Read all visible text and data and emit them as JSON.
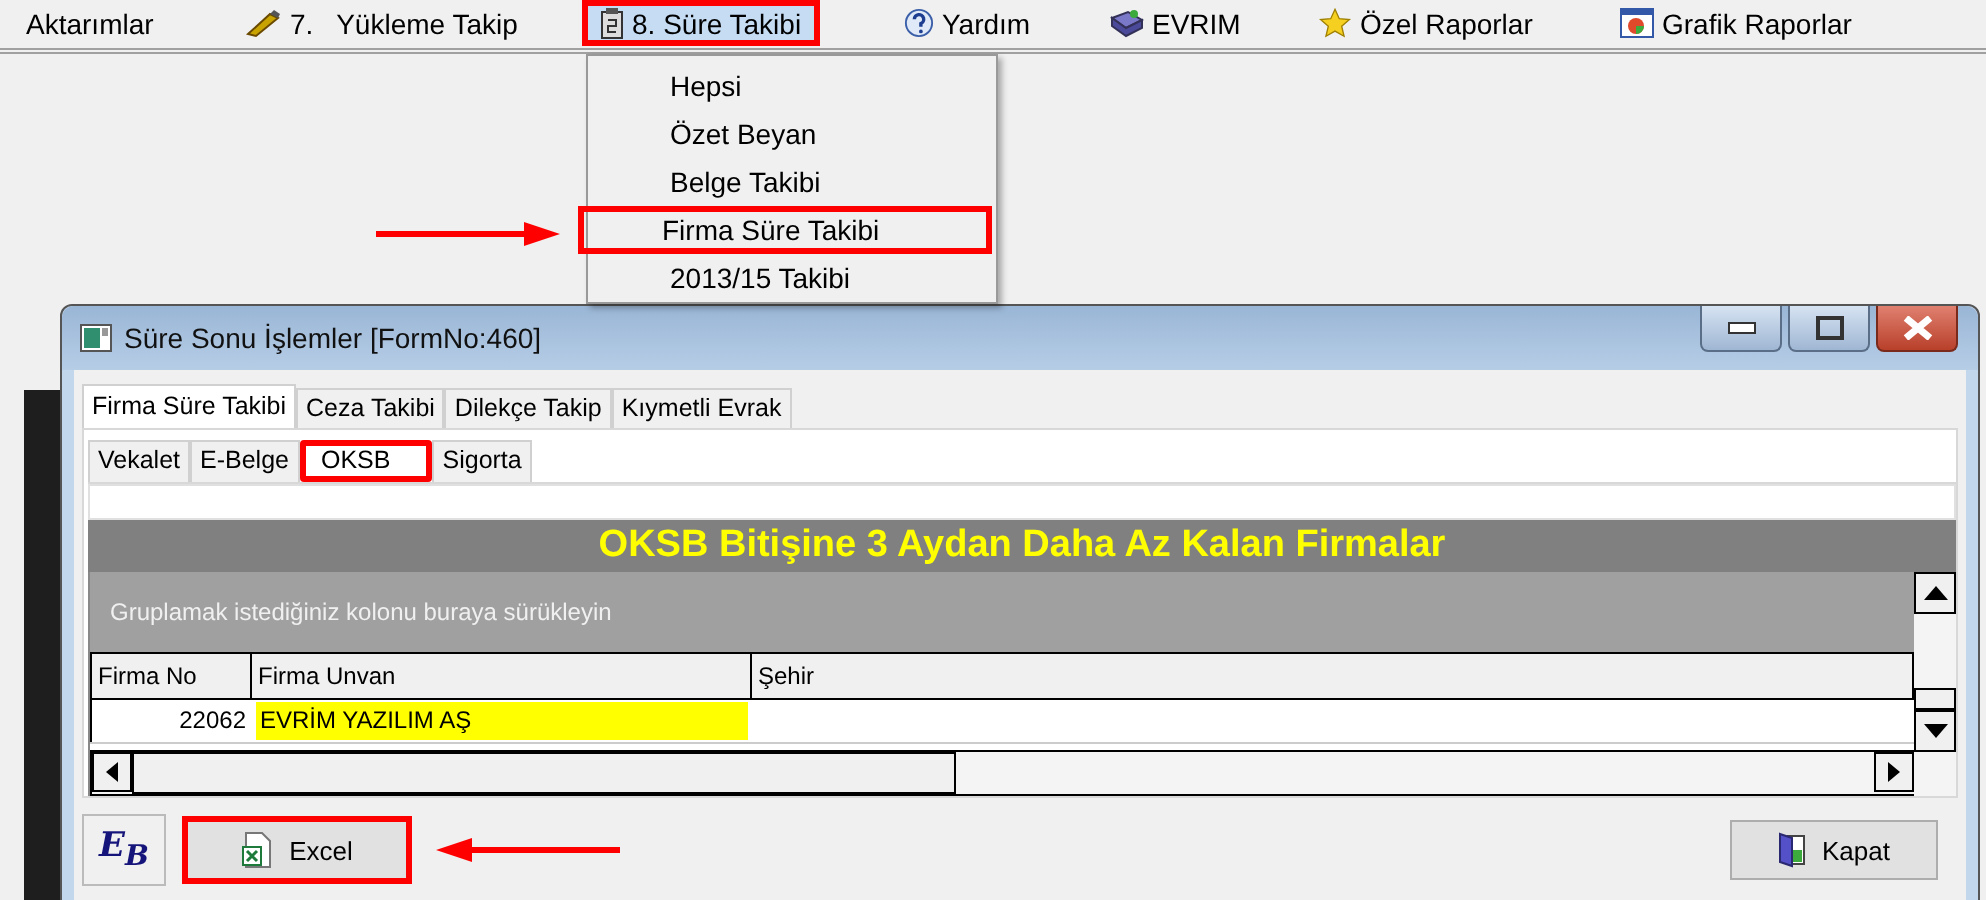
{
  "menu_bar": {
    "items": [
      {
        "label": "Aktarımlar",
        "kind": "none",
        "selected": false,
        "highlighted": false
      },
      {
        "label": "7.   Yükleme Takip",
        "kind": "pen",
        "selected": false,
        "highlighted": false
      },
      {
        "label": "8. Süre Takibi",
        "kind": "calendar",
        "selected": true,
        "highlighted": true
      },
      {
        "label": "Yardım",
        "kind": "help",
        "selected": false,
        "highlighted": false
      },
      {
        "label": "EVRIM",
        "kind": "book",
        "selected": false,
        "highlighted": false
      },
      {
        "label": "Özel Raporlar",
        "kind": "star",
        "selected": false,
        "highlighted": false
      },
      {
        "label": "Grafik Raporlar",
        "kind": "chart",
        "selected": false,
        "highlighted": false
      }
    ]
  },
  "dropdown": {
    "items": [
      {
        "label": "Hepsi",
        "highlighted": false
      },
      {
        "label": "Özet Beyan",
        "highlighted": false
      },
      {
        "label": "Belge Takibi",
        "highlighted": false
      },
      {
        "label": "Firma Süre Takibi",
        "highlighted": true
      },
      {
        "label": "2013/15 Takibi",
        "highlighted": false
      }
    ]
  },
  "window": {
    "title": "Süre Sonu İşlemler [FormNo:460]",
    "tabs": [
      {
        "label": "Firma Süre Takibi",
        "selected": true
      },
      {
        "label": "Ceza Takibi",
        "selected": false
      },
      {
        "label": "Dilekçe Takip",
        "selected": false
      },
      {
        "label": "Kıymetli Evrak",
        "selected": false
      }
    ],
    "subtabs": [
      {
        "label": "Vekalet",
        "selected": false,
        "highlighted": false
      },
      {
        "label": "E-Belge",
        "selected": false,
        "highlighted": false
      },
      {
        "label": "OKSB",
        "selected": true,
        "highlighted": true
      },
      {
        "label": "Sigorta",
        "selected": false,
        "highlighted": false
      }
    ],
    "banner": "OKSB Bitişine 3 Aydan Daha Az Kalan Firmalar",
    "group_hint": "Gruplamak istediğiniz kolonu buraya sürükleyin",
    "table": {
      "columns": [
        "Firma No",
        "Firma Unvan",
        "Şehir"
      ],
      "rows": [
        {
          "cells": [
            {
              "text": "22062",
              "active": false
            },
            {
              "text": "EVRİM YAZILIM AŞ",
              "active": true
            }
          ]
        }
      ]
    },
    "logo_button": "E$_{B}$",
    "buttons": [
      {
        "label": "Excel",
        "kind": "export",
        "highlighted": true
      },
      {
        "label": "Kapat",
        "kind": "close",
        "highlighted": false
      }
    ]
  }
}
